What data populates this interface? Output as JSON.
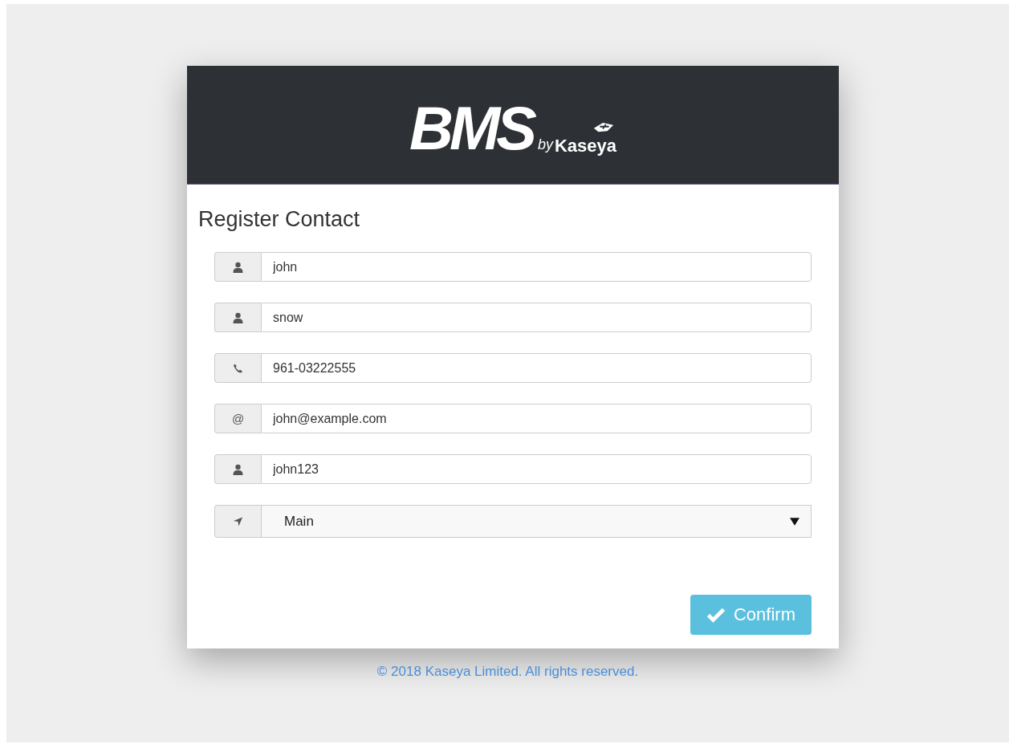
{
  "logo": {
    "title": "BMS",
    "by": "by",
    "brand": "Kaseya"
  },
  "form": {
    "title": "Register Contact",
    "fields": [
      {
        "kind": "name",
        "value": "john"
      },
      {
        "kind": "name",
        "value": "snow"
      },
      {
        "kind": "phone",
        "value": "961-03222555"
      },
      {
        "kind": "email",
        "symbol": "@",
        "value": "john@example.com"
      },
      {
        "kind": "username",
        "value": "john123"
      },
      {
        "kind": "location",
        "value": "Main"
      }
    ],
    "confirm": "Confirm"
  },
  "footer": "© 2018 Kaseya Limited. All rights reserved."
}
